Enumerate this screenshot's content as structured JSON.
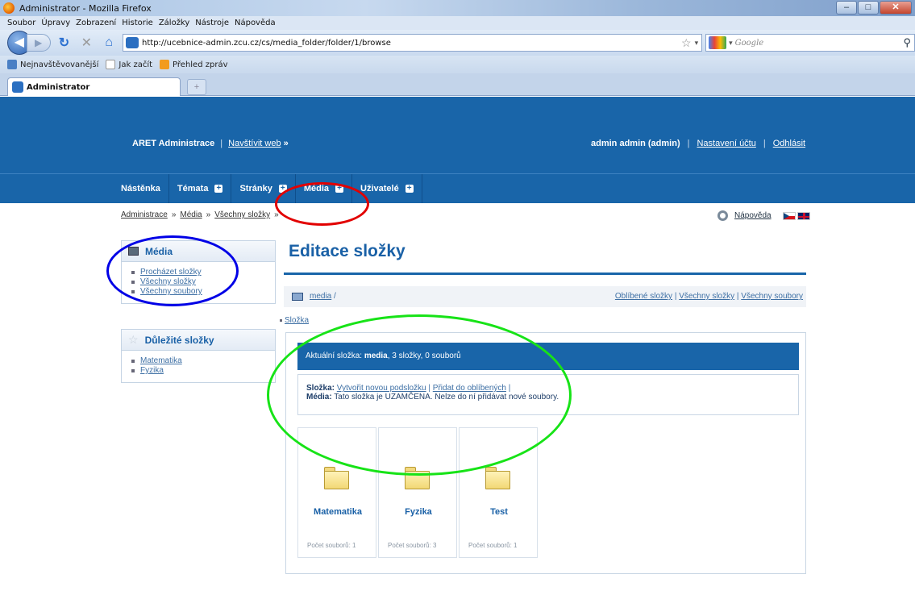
{
  "browser": {
    "window_title": "Administrator - Mozilla Firefox",
    "menu": [
      "Soubor",
      "Úpravy",
      "Zobrazení",
      "Historie",
      "Záložky",
      "Nástroje",
      "Nápověda"
    ],
    "url": "http://ucebnice-admin.zcu.cz/cs/media_folder/folder/1/browse",
    "search_placeholder": "Google",
    "bookmarks": [
      "Nejnavštěvovanější",
      "Jak začít",
      "Přehled zpráv"
    ],
    "tab_title": "Administrator"
  },
  "header": {
    "brand": "ARET Administrace",
    "sep": "|",
    "visit": "Navštívit web",
    "visit_arrow": "»",
    "user": "admin admin (admin)",
    "settings": "Nastavení účtu",
    "logout": "Odhlásit"
  },
  "nav": [
    "Nástěnka",
    "Témata",
    "Stránky",
    "Média",
    "Uživatelé"
  ],
  "breadcrumb": [
    "Administrace",
    "Média",
    "Všechny složky"
  ],
  "help": "Nápověda",
  "sidebar": {
    "media_title": "Média",
    "media_links": [
      "Procházet složky",
      "Všechny složky",
      "Všechny soubory"
    ],
    "important_title": "Důležité složky",
    "important_links": [
      "Matematika",
      "Fyzika"
    ]
  },
  "main": {
    "title": "Editace složky",
    "path_link": "media",
    "path_sep": "/",
    "path_links": [
      "Oblíbené složky",
      "Všechny složky",
      "Všechny soubory"
    ],
    "slozka_link": "Složka",
    "current": {
      "prefix": "Aktuální složka:",
      "name": "media",
      "suffix": ", 3 složky, 0 souborů"
    },
    "info": {
      "folder_label": "Složka:",
      "create": "Vytvořit novou podsložku",
      "favorite": "Přidat do oblíbených",
      "media_label": "Média:",
      "media_text": "Tato složka je UZAMČENA. Nelze do ní přidávat nové soubory."
    },
    "folders": [
      {
        "name": "Matematika",
        "count": "Počet souborů: 1"
      },
      {
        "name": "Fyzika",
        "count": "Počet souborů: 3"
      },
      {
        "name": "Test",
        "count": "Počet souborů: 1"
      }
    ]
  },
  "colors": {
    "brand_blue": "#1965a9",
    "highlight_red": "#e20000",
    "highlight_blue": "#0000e6",
    "highlight_green": "#17e317"
  }
}
